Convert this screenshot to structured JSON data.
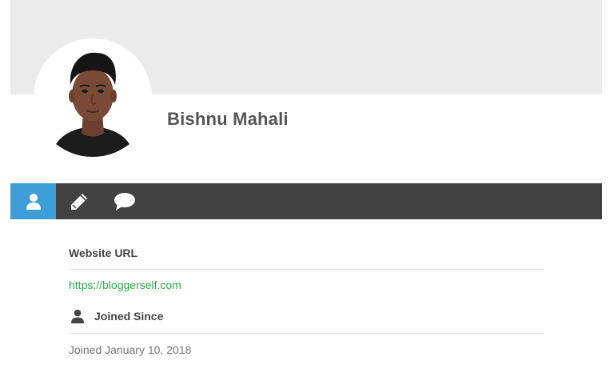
{
  "profile": {
    "name": "Bishnu Mahali",
    "avatar_icon": "person-photo"
  },
  "tabs": [
    {
      "icon": "user-icon",
      "active": true
    },
    {
      "icon": "pencil-icon",
      "active": false
    },
    {
      "icon": "comment-icon",
      "active": false
    }
  ],
  "details": {
    "website_label": "Website URL",
    "website_url": "https://bloggerself.com",
    "joined_label": "Joined Since",
    "joined_value": "Joined January 10, 2018"
  },
  "colors": {
    "cover": "#ebebeb",
    "tabbar": "#424242",
    "active_tab": "#3e9fd8",
    "link": "#2faa4f"
  }
}
